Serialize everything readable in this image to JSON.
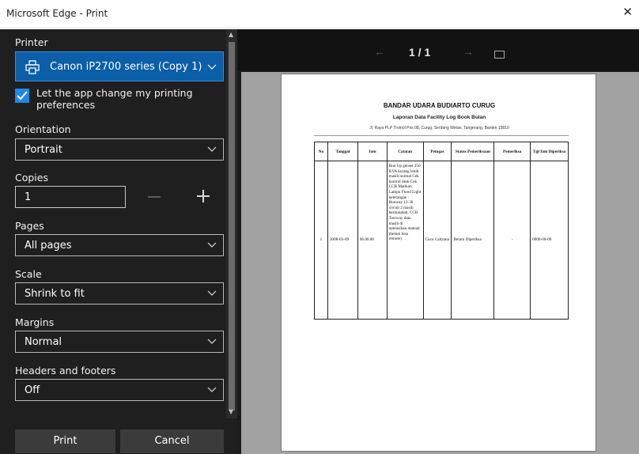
{
  "window": {
    "title": "Microsoft Edge - Print",
    "close_glyph": "✕"
  },
  "settings": {
    "printer_label": "Printer",
    "printer_value": "Canon iP2700 series (Copy 1)",
    "let_app_change_label": "Let the app change my printing preferences",
    "let_app_change_checked": true,
    "orientation_label": "Orientation",
    "orientation_value": "Portrait",
    "copies_label": "Copies",
    "copies_value": "1",
    "pages_label": "Pages",
    "pages_value": "All pages",
    "scale_label": "Scale",
    "scale_value": "Shrink to fit",
    "margins_label": "Margins",
    "margins_value": "Normal",
    "headers_footers_label": "Headers and footers",
    "headers_footers_value": "Off"
  },
  "buttons": {
    "print": "Print",
    "cancel": "Cancel"
  },
  "preview_nav": {
    "prev_glyph": "←",
    "page_indicator": "1 / 1",
    "next_glyph": "→"
  },
  "document": {
    "title": "BANDAR UDARA BUDIARTO CURUG",
    "subtitle": "Laporan Data Facility Log Book Bulan",
    "address": "Jl. Raya PLP Tromol Pos 08, Curug, Serdang Wetan, Tangerang, Banten 15810",
    "table": {
      "headers": [
        "No",
        "Tanggal",
        "Jam",
        "Catatan",
        "Petugas",
        "Status Pemeriksaan",
        "Pemeriksa",
        "Tgl/Jam Diperiksa"
      ],
      "rows": [
        {
          "no": "1",
          "tanggal": "2008-03-09",
          "jam": "06.00.00",
          "catatan": "Run Up genset 250 KVA kurang lebih masih normal Cek kontrol desk Cek CCR Matikan Lampu Flood Light keterangan : Runway 12-30 circuit 2 masih bermasalah, CCR Taxiway data masih di operasikan manual (belum bisa remote)",
          "petugas": "Cucu Cahyana",
          "status": "Belum Diperiksa",
          "pemeriksa": "-",
          "tgl_jam": "0000-00-00"
        }
      ]
    }
  }
}
